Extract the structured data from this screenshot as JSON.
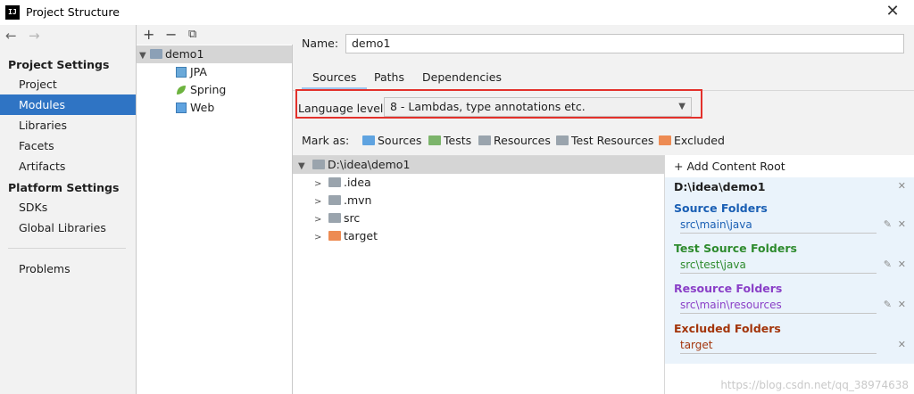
{
  "window": {
    "title": "Project Structure",
    "app_icon": "IJ"
  },
  "sidebar": {
    "project_settings_heading": "Project Settings",
    "platform_settings_heading": "Platform Settings",
    "items": {
      "project": "Project",
      "modules": "Modules",
      "libraries": "Libraries",
      "facets": "Facets",
      "artifacts": "Artifacts",
      "sdks": "SDKs",
      "global_libraries": "Global Libraries",
      "problems": "Problems"
    },
    "selected": "Modules"
  },
  "module_tree": {
    "toolbar": {
      "add": "+",
      "remove": "−",
      "copy": "⧉"
    },
    "root": "demo1",
    "facets": [
      "JPA",
      "Spring",
      "Web"
    ]
  },
  "main": {
    "name_label": "Name:",
    "name_value": "demo1",
    "tabs": [
      "Sources",
      "Paths",
      "Dependencies"
    ],
    "active_tab": "Sources",
    "language_level_label": "Language level:",
    "language_level_value": "8 - Lambdas, type annotations etc.",
    "mark_as_label": "Mark as:",
    "mark_as": {
      "sources": "Sources",
      "tests": "Tests",
      "resources": "Resources",
      "test_resources": "Test Resources",
      "excluded": "Excluded"
    }
  },
  "content_tree": {
    "root": "D:\\idea\\demo1",
    "children": [
      ".idea",
      ".mvn",
      "src",
      "target"
    ]
  },
  "content_roots": {
    "add_label": "+ Add Content Root",
    "root_path": "D:\\idea\\demo1",
    "source_heading": "Source Folders",
    "source_path": "src\\main\\java",
    "test_heading": "Test Source Folders",
    "test_path": "src\\test\\java",
    "resource_heading": "Resource Folders",
    "resource_path": "src\\main\\resources",
    "excluded_heading": "Excluded Folders",
    "excluded_path": "target"
  },
  "watermark": "https://blog.csdn.net/qq_38974638",
  "colors": {
    "selection": "#2f74c4",
    "highlight_box": "#e3312b",
    "source": "#1a5fb4",
    "test": "#2e8b2e",
    "resource": "#8a3fc7",
    "excluded": "#a3350b"
  }
}
